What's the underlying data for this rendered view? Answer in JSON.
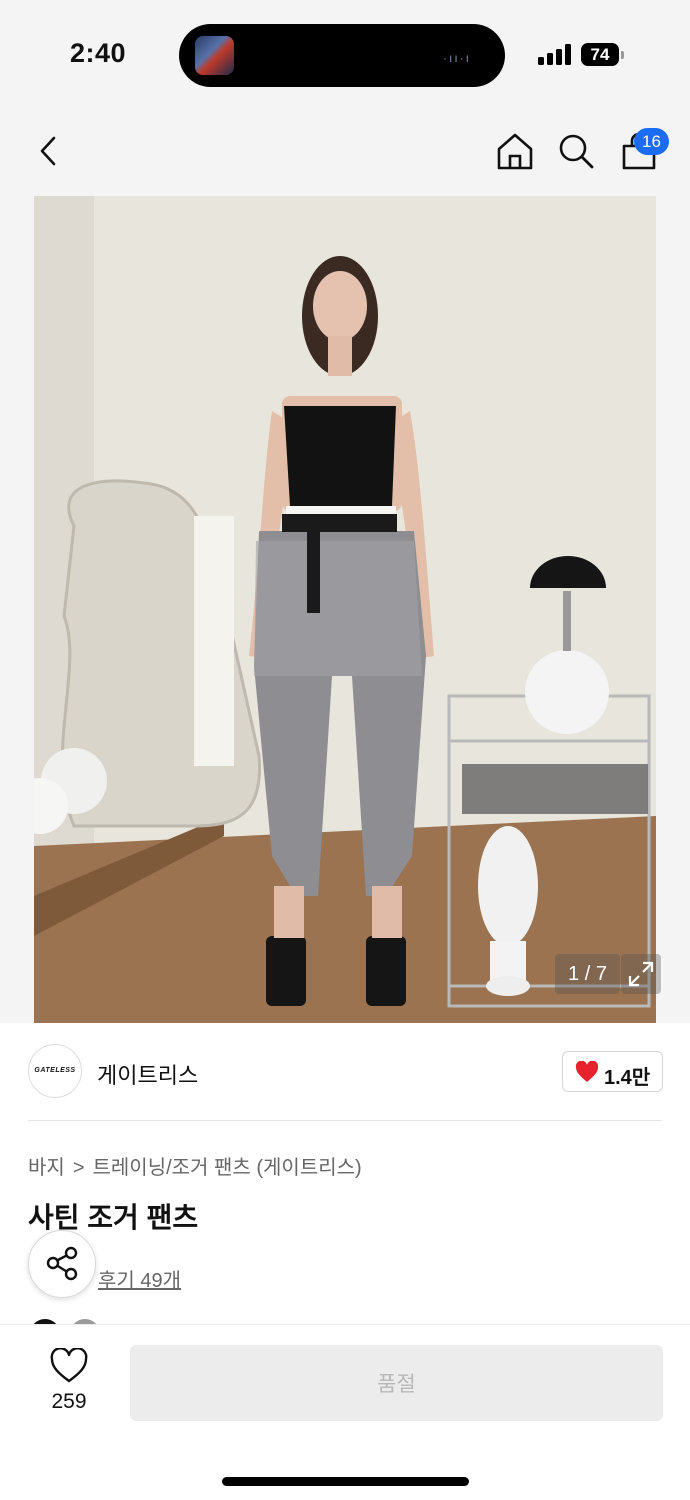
{
  "status_bar": {
    "time": "2:40",
    "battery": "74"
  },
  "header": {
    "cart_count": "16"
  },
  "gallery": {
    "counter": "1 / 7"
  },
  "brand": {
    "logo_text": "GATELESS",
    "name": "게이트리스",
    "likes": "1.4만"
  },
  "product": {
    "breadcrumb": [
      "바지",
      "트레이닝/조거 팬츠 (게이트리스)"
    ],
    "breadcrumb_separator": ">",
    "title": "사틴 조거 팬츠",
    "review_link": "후기 49개"
  },
  "bottom_bar": {
    "wish_count": "259",
    "soldout_label": "품절"
  },
  "colors": {
    "accent": "#1a6cf5",
    "heart": "#e8232d",
    "soldout_bg": "#ececec"
  }
}
